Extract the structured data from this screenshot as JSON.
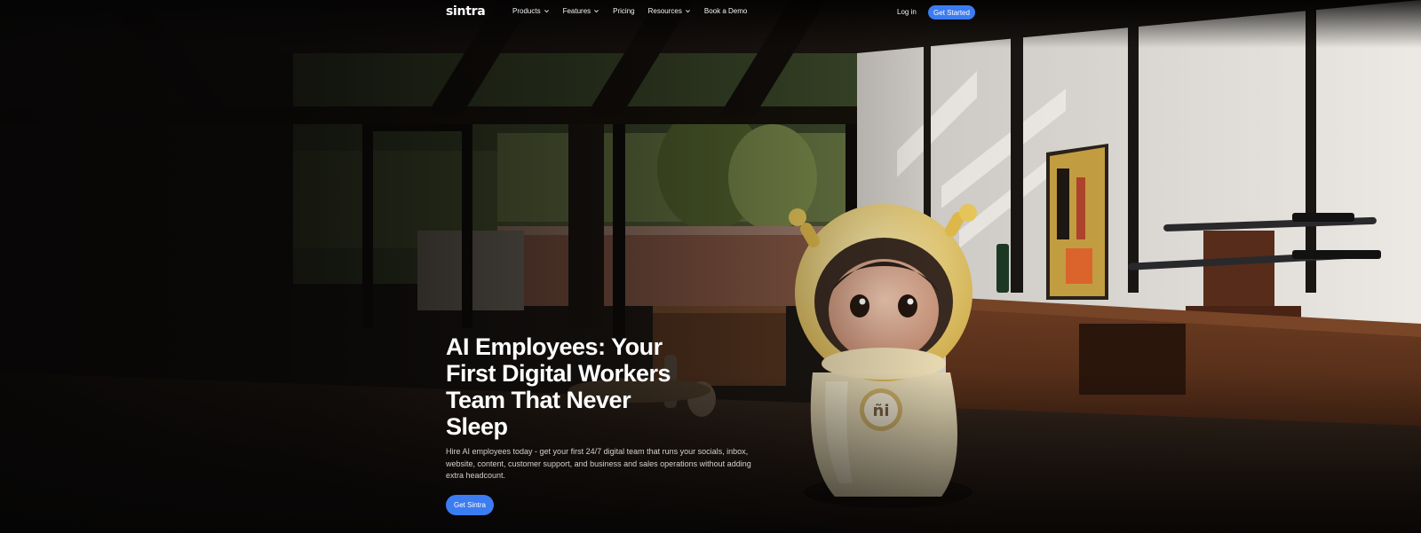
{
  "nav": {
    "logo": "sintra",
    "links": [
      {
        "label": "Products",
        "has_dropdown": true
      },
      {
        "label": "Features",
        "has_dropdown": true
      },
      {
        "label": "Pricing",
        "has_dropdown": false
      },
      {
        "label": "Resources",
        "has_dropdown": true
      },
      {
        "label": "Book a Demo",
        "has_dropdown": false
      }
    ],
    "login_label": "Log in",
    "cta_label": "Get Started"
  },
  "hero": {
    "title": "AI Employees: Your First Digital Workers Team That Never Sleep",
    "subtitle": "Hire AI employees today - get your first 24/7 digital team that runs your socials, inbox, website, content, customer support, and business and sales operations without adding extra headcount.",
    "cta_label": "Get Sintra",
    "mascot_badge": "ñi"
  },
  "colors": {
    "accent": "#3b7cf2",
    "background": "#0b0908",
    "text_primary": "#ffffff",
    "text_secondary": "#d4d1cd"
  },
  "icons": {
    "dropdown": "chevron-down-icon"
  }
}
